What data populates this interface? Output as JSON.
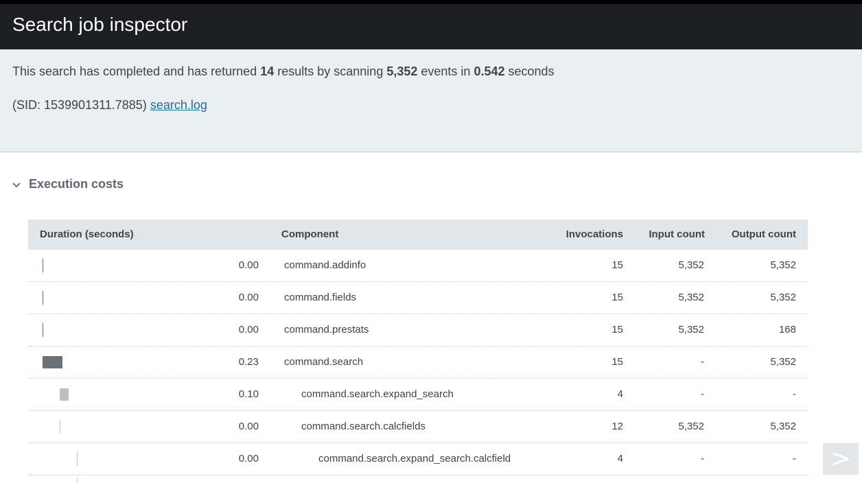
{
  "header": {
    "title": "Search job inspector"
  },
  "summary": {
    "prefix": "This search has completed and has returned ",
    "results": "14",
    "mid1": " results by scanning ",
    "events": "5,352",
    "mid2": " events in ",
    "seconds": "0.542",
    "suffix": " seconds",
    "sid_text": "(SID: 1539901311.7885) ",
    "log_link": "search.log"
  },
  "section": {
    "title": "Execution costs",
    "icon": "chevron-down-icon"
  },
  "table": {
    "headers": {
      "duration": "Duration (seconds)",
      "component": "Component",
      "invocations": "Invocations",
      "input": "Input count",
      "output": "Output count"
    },
    "rows": [
      {
        "duration": "0.00",
        "component": "command.addinfo",
        "invocations": "15",
        "input": "5,352",
        "output": "5,352",
        "level": 0,
        "bar_fraction": 0.0,
        "bar_color": "#5c6773"
      },
      {
        "duration": "0.00",
        "component": "command.fields",
        "invocations": "15",
        "input": "5,352",
        "output": "5,352",
        "level": 0,
        "bar_fraction": 0.0,
        "bar_color": "#5c6773"
      },
      {
        "duration": "0.00",
        "component": "command.prestats",
        "invocations": "15",
        "input": "5,352",
        "output": "168",
        "level": 0,
        "bar_fraction": 0.0,
        "bar_color": "#5c6773"
      },
      {
        "duration": "0.23",
        "component": "command.search",
        "invocations": "15",
        "input": "-",
        "output": "5,352",
        "level": 0,
        "bar_fraction": 0.23,
        "bar_color": "#6b7178"
      },
      {
        "duration": "0.10",
        "component": "command.search.expand_search",
        "invocations": "4",
        "input": "-",
        "output": "-",
        "level": 1,
        "bar_fraction": 0.1,
        "bar_color": "#bcbfc3"
      },
      {
        "duration": "0.00",
        "component": "command.search.calcfields",
        "invocations": "12",
        "input": "5,352",
        "output": "5,352",
        "level": 1,
        "bar_fraction": 0.0,
        "bar_color": "#bcbfc3"
      },
      {
        "duration": "0.00",
        "component": "command.search.expand_search.calcfield",
        "invocations": "4",
        "input": "-",
        "output": "-",
        "level": 2,
        "bar_fraction": 0.0,
        "bar_color": "#bcbfc3"
      }
    ]
  },
  "nav": {
    "next_label": ">"
  }
}
